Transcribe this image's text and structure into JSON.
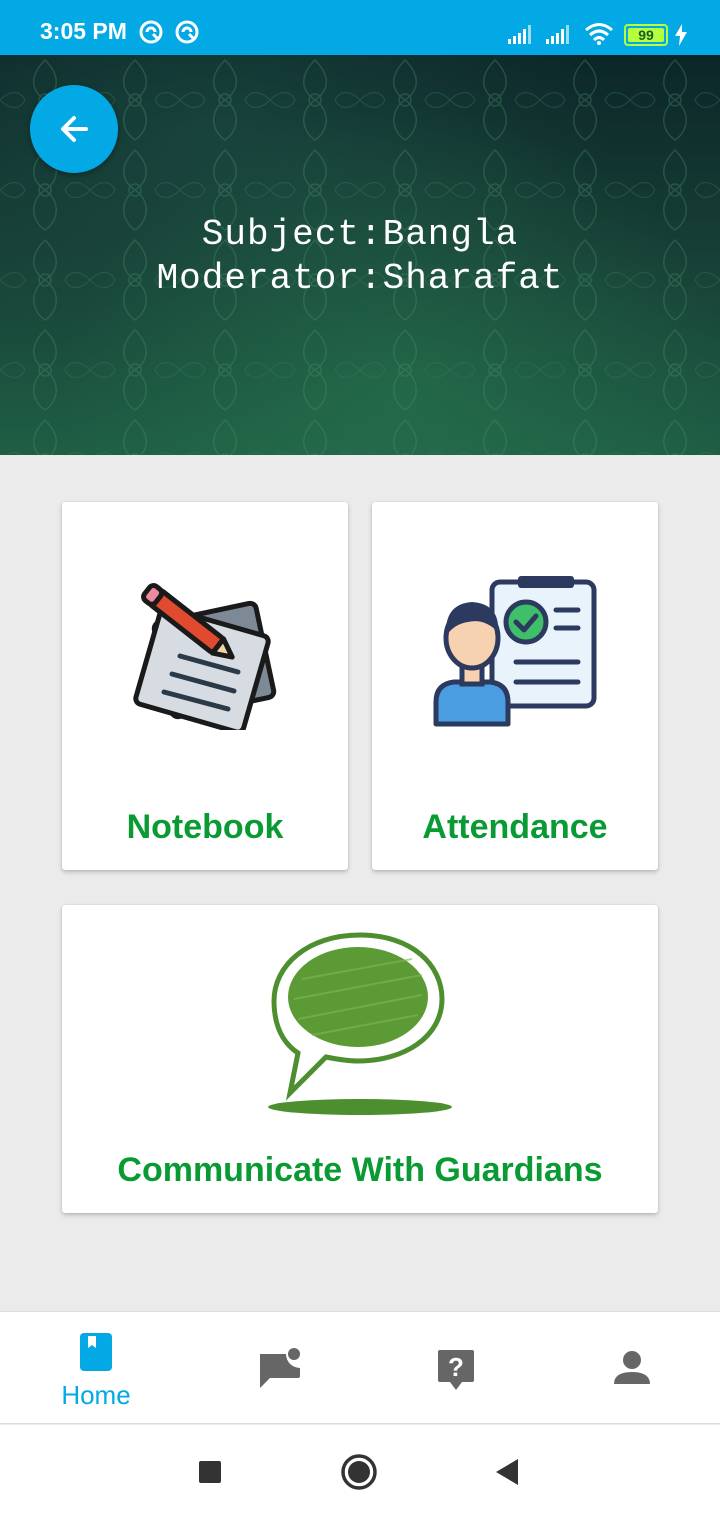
{
  "status_bar": {
    "time": "3:05 PM",
    "battery": "99",
    "battery_level": 0.99,
    "icons": [
      "sync-icon",
      "sync-icon",
      "signal-icon",
      "signal-icon",
      "wifi-icon",
      "battery-icon",
      "charging-icon"
    ]
  },
  "header": {
    "subject_line": "Subject:Bangla",
    "moderator_line": "Moderator:Sharafat",
    "back_icon": "arrow-left-icon"
  },
  "cards": {
    "notebook": {
      "label": "Notebook",
      "icon": "notebook-pencil-icon"
    },
    "attendance": {
      "label": "Attendance",
      "icon": "attendance-clipboard-icon"
    },
    "communicate": {
      "label": "Communicate With Guardians",
      "icon": "speech-bubble-icon"
    }
  },
  "bottom_nav": {
    "items": [
      {
        "label": "Home",
        "icon": "book-icon",
        "active": true
      },
      {
        "label": "",
        "icon": "chat-notification-icon",
        "active": false
      },
      {
        "label": "",
        "icon": "help-icon",
        "active": false
      },
      {
        "label": "",
        "icon": "person-icon",
        "active": false
      }
    ]
  },
  "system_nav": {
    "icons": [
      "recents-icon",
      "home-icon",
      "back-icon"
    ]
  },
  "colors": {
    "accent": "#03a9e4",
    "label_green": "#0a9a34",
    "nav_gray": "#666666",
    "background": "#ebebeb"
  }
}
